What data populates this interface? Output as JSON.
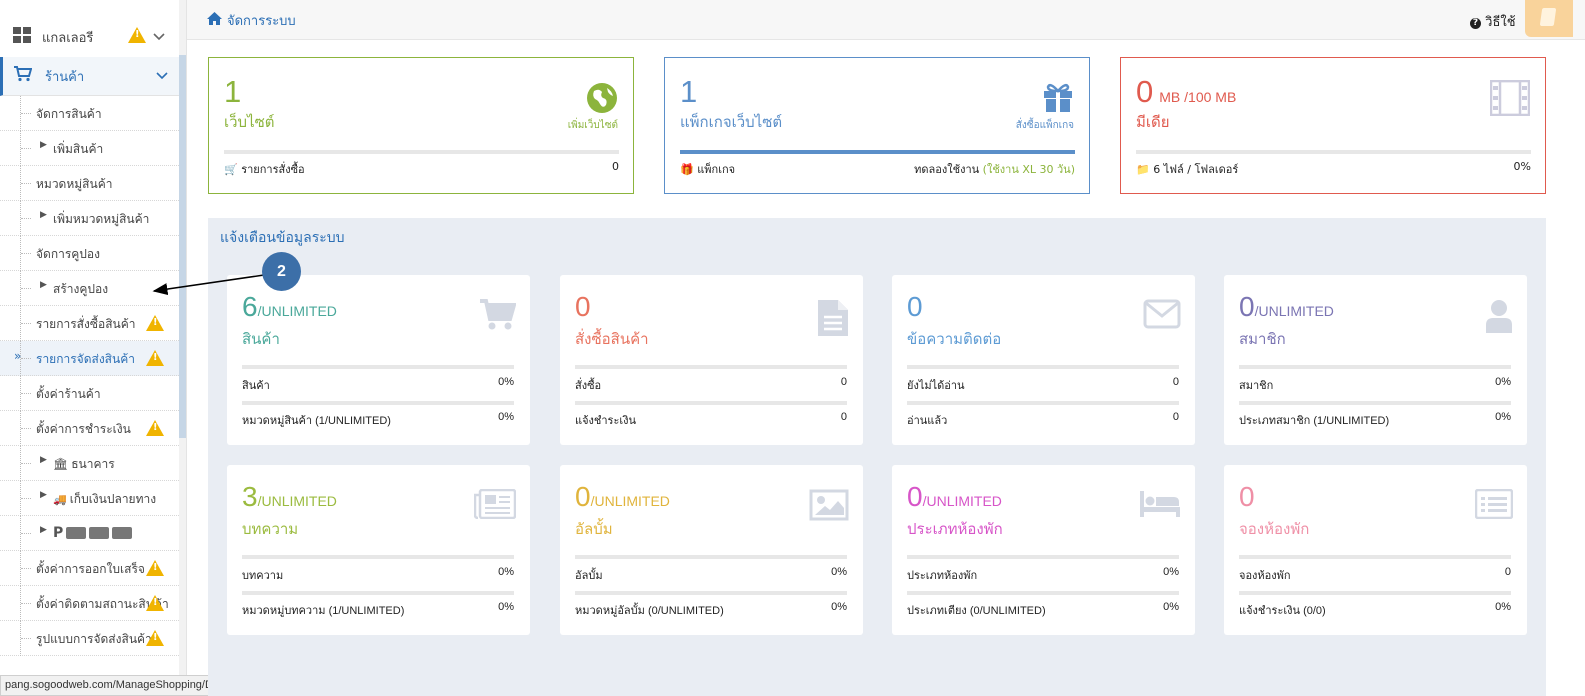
{
  "sidebar": {
    "gallery_label": "แกลเลอรี",
    "shop_label": "ร้านค้า",
    "items": [
      {
        "label": "จัดการสินค้า",
        "child": false
      },
      {
        "label": "เพิ่มสินค้า",
        "child": true
      },
      {
        "label": "หมวดหมู่สินค้า",
        "child": false
      },
      {
        "label": "เพิ่มหมวดหมู่สินค้า",
        "child": true
      },
      {
        "label": "จัดการคูปอง",
        "child": false
      },
      {
        "label": "สร้างคูปอง",
        "child": true
      },
      {
        "label": "รายการสั่งซื้อสินค้า",
        "child": false,
        "warn": true
      },
      {
        "label": "รายการจัดส่งสินค้า",
        "child": false,
        "warn": true,
        "active": true
      },
      {
        "label": "ตั้งค่าร้านค้า",
        "child": false
      },
      {
        "label": "ตั้งค่าการชำระเงิน",
        "child": false,
        "warn": true
      },
      {
        "label": "ธนาคาร",
        "child": true,
        "icon": "bank-icon"
      },
      {
        "label": "เก็บเงินปลายทาง",
        "child": true,
        "icon": "truck-icon"
      },
      {
        "label": "",
        "child": true,
        "icon": "payment-cards-icon"
      },
      {
        "label": "ตั้งค่าการออกใบเสร็จ",
        "child": false,
        "warn": true
      },
      {
        "label": "ตั้งค่าติดตามสถานะสินค้า",
        "child": false,
        "warn": true
      },
      {
        "label": "รูปแบบการจัดส่งสินค้า",
        "child": false,
        "warn": true
      }
    ]
  },
  "statusbar": "pang.sogoodweb.com/ManageShopping/Delivery",
  "header": {
    "breadcrumb": "จัดการระบบ",
    "help_label": "วิธีใช้"
  },
  "top_cards": [
    {
      "value": "1",
      "unit": "",
      "title": "เว็บไซต์",
      "link": "เพิ่มเว็บไซต์",
      "foot_left": "รายการสั่งซื้อ",
      "foot_right": "0",
      "foot_right_extra": "",
      "fill": 0,
      "color": "#8cb43c",
      "icon": "globe-icon"
    },
    {
      "value": "1",
      "unit": "",
      "title": "แพ็กเกจเว็บไซต์",
      "link": "สั่งซื้อแพ็กเกจ",
      "foot_left": "แพ็กเกจ",
      "foot_right": "ทดลองใช้งาน",
      "foot_right_extra": "(ใช้งาน XL 30 วัน)",
      "fill": 1,
      "color": "#5b8fc9",
      "icon": "gift-icon"
    },
    {
      "value": "0",
      "unit": "MB /100 MB",
      "title": "มีเดีย",
      "link": "",
      "foot_left": "6 ไฟล์ / โฟลเดอร์",
      "foot_right": "0%",
      "foot_right_extra": "",
      "fill": 0,
      "color": "#e05a4e",
      "icon": "film-icon"
    }
  ],
  "alert_title": "แจ้งเตือนข้อมูลระบบ",
  "stat_cards": [
    {
      "value": "6",
      "unit": "/UNLIMITED",
      "title": "สินค้า",
      "color": "#4aa89a",
      "icon": "cart-icon",
      "rows": [
        {
          "l": "สินค้า",
          "r": "0%"
        },
        {
          "l": "หมวดหมู่สินค้า (1/UNLIMITED)",
          "r": "0%"
        }
      ]
    },
    {
      "value": "0",
      "unit": "",
      "title": "สั่งซื้อสินค้า",
      "color": "#e8735f",
      "icon": "document-icon",
      "rows": [
        {
          "l": "สั่งซื้อ",
          "r": "0"
        },
        {
          "l": "แจ้งชำระเงิน",
          "r": "0"
        }
      ]
    },
    {
      "value": "0",
      "unit": "",
      "title": "ข้อความติดต่อ",
      "color": "#5d9bd4",
      "icon": "envelope-icon",
      "rows": [
        {
          "l": "ยังไม่ได้อ่าน",
          "r": "0"
        },
        {
          "l": "อ่านแล้ว",
          "r": "0"
        }
      ]
    },
    {
      "value": "0",
      "unit": "/UNLIMITED",
      "title": "สมาชิก",
      "color": "#7b75b3",
      "icon": "user-icon",
      "rows": [
        {
          "l": "สมาชิก",
          "r": "0%"
        },
        {
          "l": "ประเภทสมาชิก (1/UNLIMITED)",
          "r": "0%"
        }
      ]
    },
    {
      "value": "3",
      "unit": "/UNLIMITED",
      "title": "บทความ",
      "color": "#9bbb3f",
      "icon": "newspaper-icon",
      "rows": [
        {
          "l": "บทความ",
          "r": "0%"
        },
        {
          "l": "หมวดหมู่บทความ (1/UNLIMITED)",
          "r": "0%"
        }
      ]
    },
    {
      "value": "0",
      "unit": "/UNLIMITED",
      "title": "อัลบั้ม",
      "color": "#e0b43c",
      "icon": "picture-icon",
      "rows": [
        {
          "l": "อัลบั้ม",
          "r": "0%"
        },
        {
          "l": "หมวดหมู่อัลบั้ม (0/UNLIMITED)",
          "r": "0%"
        }
      ]
    },
    {
      "value": "0",
      "unit": "/UNLIMITED",
      "title": "ประเภทห้องพัก",
      "color": "#d755c8",
      "icon": "bed-icon",
      "rows": [
        {
          "l": "ประเภทห้องพัก",
          "r": "0%"
        },
        {
          "l": "ประเภทเตียง (0/UNLIMITED)",
          "r": "0%"
        }
      ]
    },
    {
      "value": "0",
      "unit": "",
      "title": "จองห้องพัก",
      "color": "#ef8fa6",
      "icon": "list-icon",
      "rows": [
        {
          "l": "จองห้องพัก",
          "r": "0"
        },
        {
          "l": "แจ้งชำระเงิน (0/0)",
          "r": "0%"
        }
      ]
    }
  ],
  "annotation_badge": "2"
}
